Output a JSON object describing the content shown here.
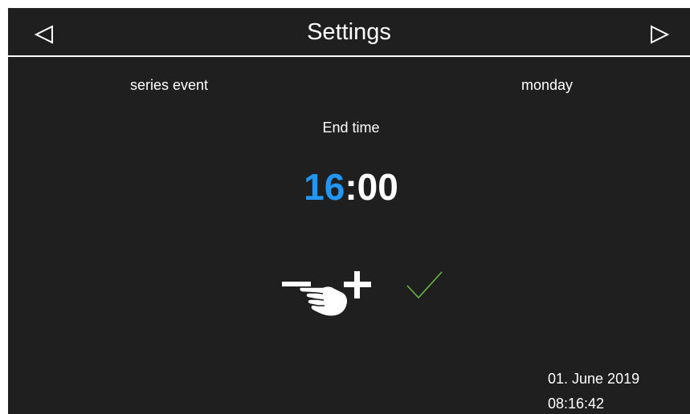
{
  "header": {
    "title": "Settings",
    "prev_icon": "triangle-left-icon",
    "next_icon": "triangle-right-icon"
  },
  "event": {
    "type_label": "series event",
    "day_label": "monday"
  },
  "editor": {
    "field_label": "End time",
    "hours": "16",
    "separator": ":",
    "minutes": "00",
    "hours_color": "#2196f3"
  },
  "controls": {
    "minus_icon": "minus-icon",
    "plus_icon": "plus-icon",
    "confirm_icon": "checkmark-icon",
    "confirm_color": "#6abf40",
    "hint_icon": "hand-pointer-icon"
  },
  "footer": {
    "date": "01. June 2019",
    "time": "08:16:42"
  }
}
